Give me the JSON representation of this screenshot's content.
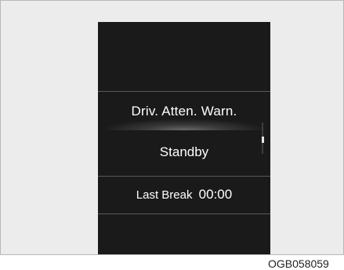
{
  "display": {
    "title": "Driv. Atten. Warn.",
    "status": "Standby",
    "last_break_label": "Last Break",
    "last_break_time": "00:00"
  },
  "figure_code": "OGB058059",
  "icons": {
    "scrollbar": "scrollbar"
  }
}
